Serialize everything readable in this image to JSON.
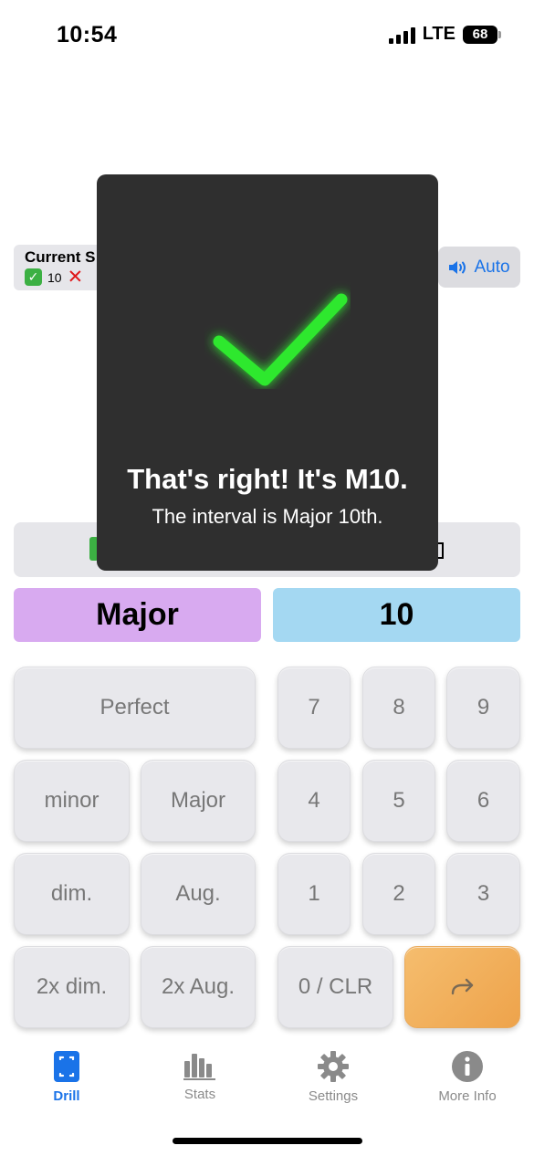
{
  "status_bar": {
    "time": "10:54",
    "network": "LTE",
    "battery": "68"
  },
  "score": {
    "title": "Current S",
    "correct_count": "10",
    "check_glyph": "✓",
    "wrong_glyph": "✕"
  },
  "auto_button": {
    "label": "Auto",
    "icon": "speaker-icon"
  },
  "answer": {
    "quality": "Major",
    "number": "10"
  },
  "keypad": {
    "quality_keys": [
      "Perfect",
      "minor",
      "Major",
      "dim.",
      "Aug.",
      "2x dim.",
      "2x Aug."
    ],
    "number_keys": [
      "7",
      "8",
      "9",
      "4",
      "5",
      "6",
      "1",
      "2",
      "3",
      "0 / CLR"
    ],
    "submit_icon": "arrow-right-icon"
  },
  "feedback": {
    "title": "That's right! It's M10.",
    "subtitle": "The interval is Major 10th.",
    "icon": "checkmark-icon",
    "color": "#2ee82e"
  },
  "tabs": [
    {
      "label": "Drill",
      "icon": "drill-icon",
      "active": true
    },
    {
      "label": "Stats",
      "icon": "bar-chart-icon",
      "active": false
    },
    {
      "label": "Settings",
      "icon": "gear-icon",
      "active": false
    },
    {
      "label": "More Info",
      "icon": "info-icon",
      "active": false
    }
  ],
  "colors": {
    "accent": "#1a73e8",
    "quality_bg": "#d8aaf0",
    "number_bg": "#a4d8f2",
    "submit_bg": "#eea34b"
  }
}
